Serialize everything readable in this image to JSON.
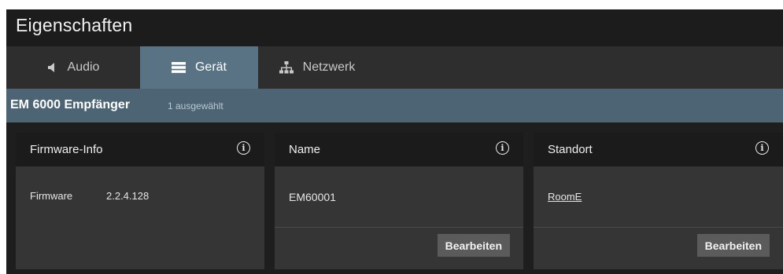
{
  "window": {
    "title": "Eigenschaften"
  },
  "tabs": [
    {
      "label": "Audio",
      "icon": "speaker-icon",
      "active": false
    },
    {
      "label": "Gerät",
      "icon": "device-icon",
      "active": true
    },
    {
      "label": "Netzwerk",
      "icon": "network-icon",
      "active": false
    }
  ],
  "device": {
    "name": "EM 6000 Empfänger",
    "selection": "1 ausgewählt"
  },
  "cards": {
    "firmware": {
      "title": "Firmware-Info",
      "label": "Firmware",
      "value": "2.2.4.128"
    },
    "name": {
      "title": "Name",
      "value": "EM60001",
      "button": "Bearbeiten"
    },
    "location": {
      "title": "Standort",
      "value": "RoomE",
      "button": "Bearbeiten"
    }
  },
  "colors": {
    "active_tab": "#5a7384",
    "device_bar": "#4d6475",
    "panel": "#353535",
    "panel_header": "#1b1b1b"
  }
}
